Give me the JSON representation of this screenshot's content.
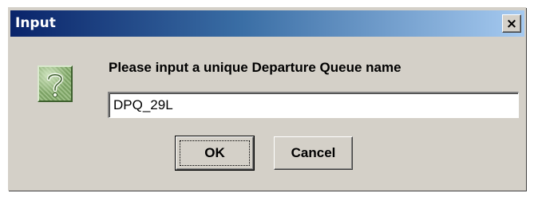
{
  "window": {
    "title": "Input",
    "close_glyph": "×",
    "icon": "question-icon"
  },
  "message": {
    "prompt": "Please input a unique Departure Queue name"
  },
  "input": {
    "value": "DPQ_29L",
    "placeholder": ""
  },
  "buttons": {
    "ok_label": "OK",
    "cancel_label": "Cancel"
  },
  "colors": {
    "dialog_bg": "#d4d0c8",
    "title_gradient_start": "#0a246a",
    "title_gradient_end": "#a6caf0",
    "icon_green": "#8fb27a"
  }
}
